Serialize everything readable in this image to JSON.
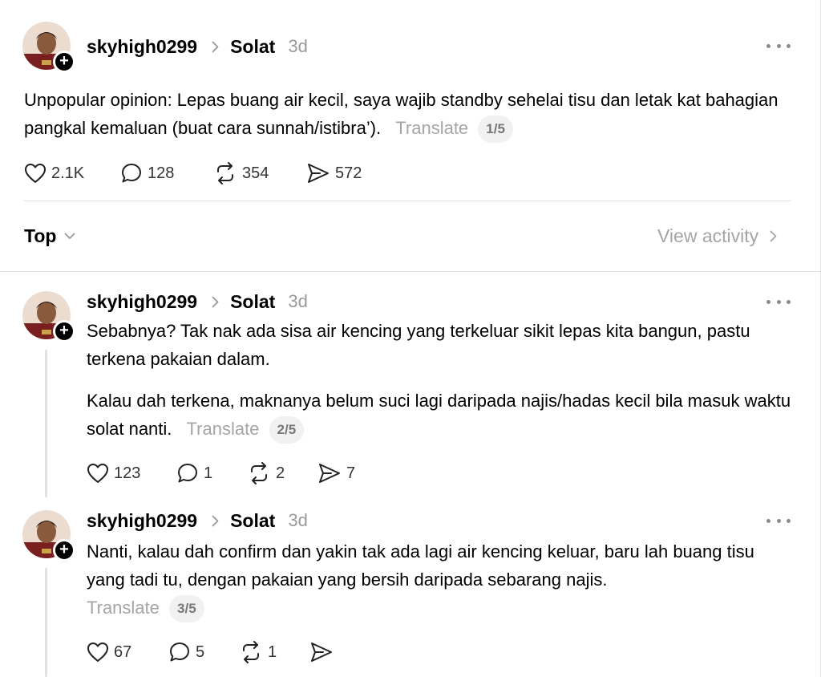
{
  "main_post": {
    "username": "skyhigh0299",
    "community": "Solat",
    "time": "3d",
    "text": "Unpopular opinion: Lepas buang air kecil, saya wajib standby sehelai tisu dan letak kat bahagian pangkal kemaluan (buat cara sunnah/istibra’).",
    "translate": "Translate",
    "page": "1/5",
    "likes": "2.1K",
    "replies": "128",
    "reposts": "354",
    "shares": "572"
  },
  "sort": {
    "label": "Top",
    "view_activity": "View activity"
  },
  "replies": [
    {
      "username": "skyhigh0299",
      "community": "Solat",
      "time": "3d",
      "paragraphs": [
        "Sebabnya? Tak nak ada sisa air kencing yang terkeluar sikit lepas kita bangun, pastu terkena pakaian dalam.",
        "Kalau dah terkena, maknanya belum suci lagi daripada najis/hadas kecil bila masuk waktu solat nanti."
      ],
      "translate": "Translate",
      "page": "2/5",
      "likes": "123",
      "replies": "1",
      "reposts": "2",
      "shares": "7"
    },
    {
      "username": "skyhigh0299",
      "community": "Solat",
      "time": "3d",
      "paragraphs": [
        "Nanti, kalau dah confirm dan yakin tak ada lagi air kencing keluar, baru lah buang tisu yang tadi tu, dengan pakaian yang bersih daripada sebarang najis."
      ],
      "translate": "Translate",
      "page": "3/5",
      "likes": "67",
      "replies": "5",
      "reposts": "1",
      "shares": ""
    }
  ],
  "icons": {
    "like": "heart-icon",
    "reply": "comment-icon",
    "repost": "repost-icon",
    "share": "send-icon",
    "more": "more-icon",
    "follow": "plus-icon"
  }
}
